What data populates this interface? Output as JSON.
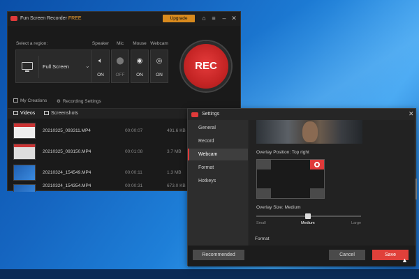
{
  "app": {
    "title": "Fun Screen Recorder",
    "title_suffix": "FREE",
    "upgrade_label": "Upgrade"
  },
  "capture": {
    "region_label": "Select a region:",
    "region_value": "Full Screen",
    "speaker": {
      "label": "Speaker",
      "state": "ON"
    },
    "mic": {
      "label": "Mic",
      "state": "OFF"
    },
    "mouse": {
      "label": "Mouse",
      "state": "ON"
    },
    "webcam": {
      "label": "Webcam",
      "state": "ON"
    },
    "rec_label": "REC"
  },
  "subtabs": {
    "my_creations": "My Creations",
    "recording_settings": "Recording Settings"
  },
  "list_tabs": {
    "videos": "Videos",
    "screenshots": "Screenshots"
  },
  "files": [
    {
      "name": "20210325_093311.MP4",
      "duration": "00:00:07",
      "size": "491.6 KB"
    },
    {
      "name": "20210325_093150.MP4",
      "duration": "00:01:08",
      "size": "3.7 MB"
    },
    {
      "name": "20210324_154549.MP4",
      "duration": "00:00:11",
      "size": "1.3 MB"
    },
    {
      "name": "20210324_154354.MP4",
      "duration": "00:00:31",
      "size": "673.0 KB"
    }
  ],
  "settings": {
    "title": "Settings",
    "nav": [
      "General",
      "Record",
      "Webcam",
      "Format",
      "Hotkeys"
    ],
    "active_nav": "Webcam",
    "overlay_position_label": "Overlay Position: Top right",
    "overlay_size_label": "Overlay Size: Medium",
    "size_options": [
      "Small",
      "Medium",
      "Large"
    ],
    "size_selected": "Medium",
    "format_label": "Format",
    "buttons": {
      "recommended": "Recommended",
      "cancel": "Cancel",
      "save": "Save"
    }
  },
  "colors": {
    "accent": "#e03a3a",
    "upgrade": "#d88a1e"
  }
}
